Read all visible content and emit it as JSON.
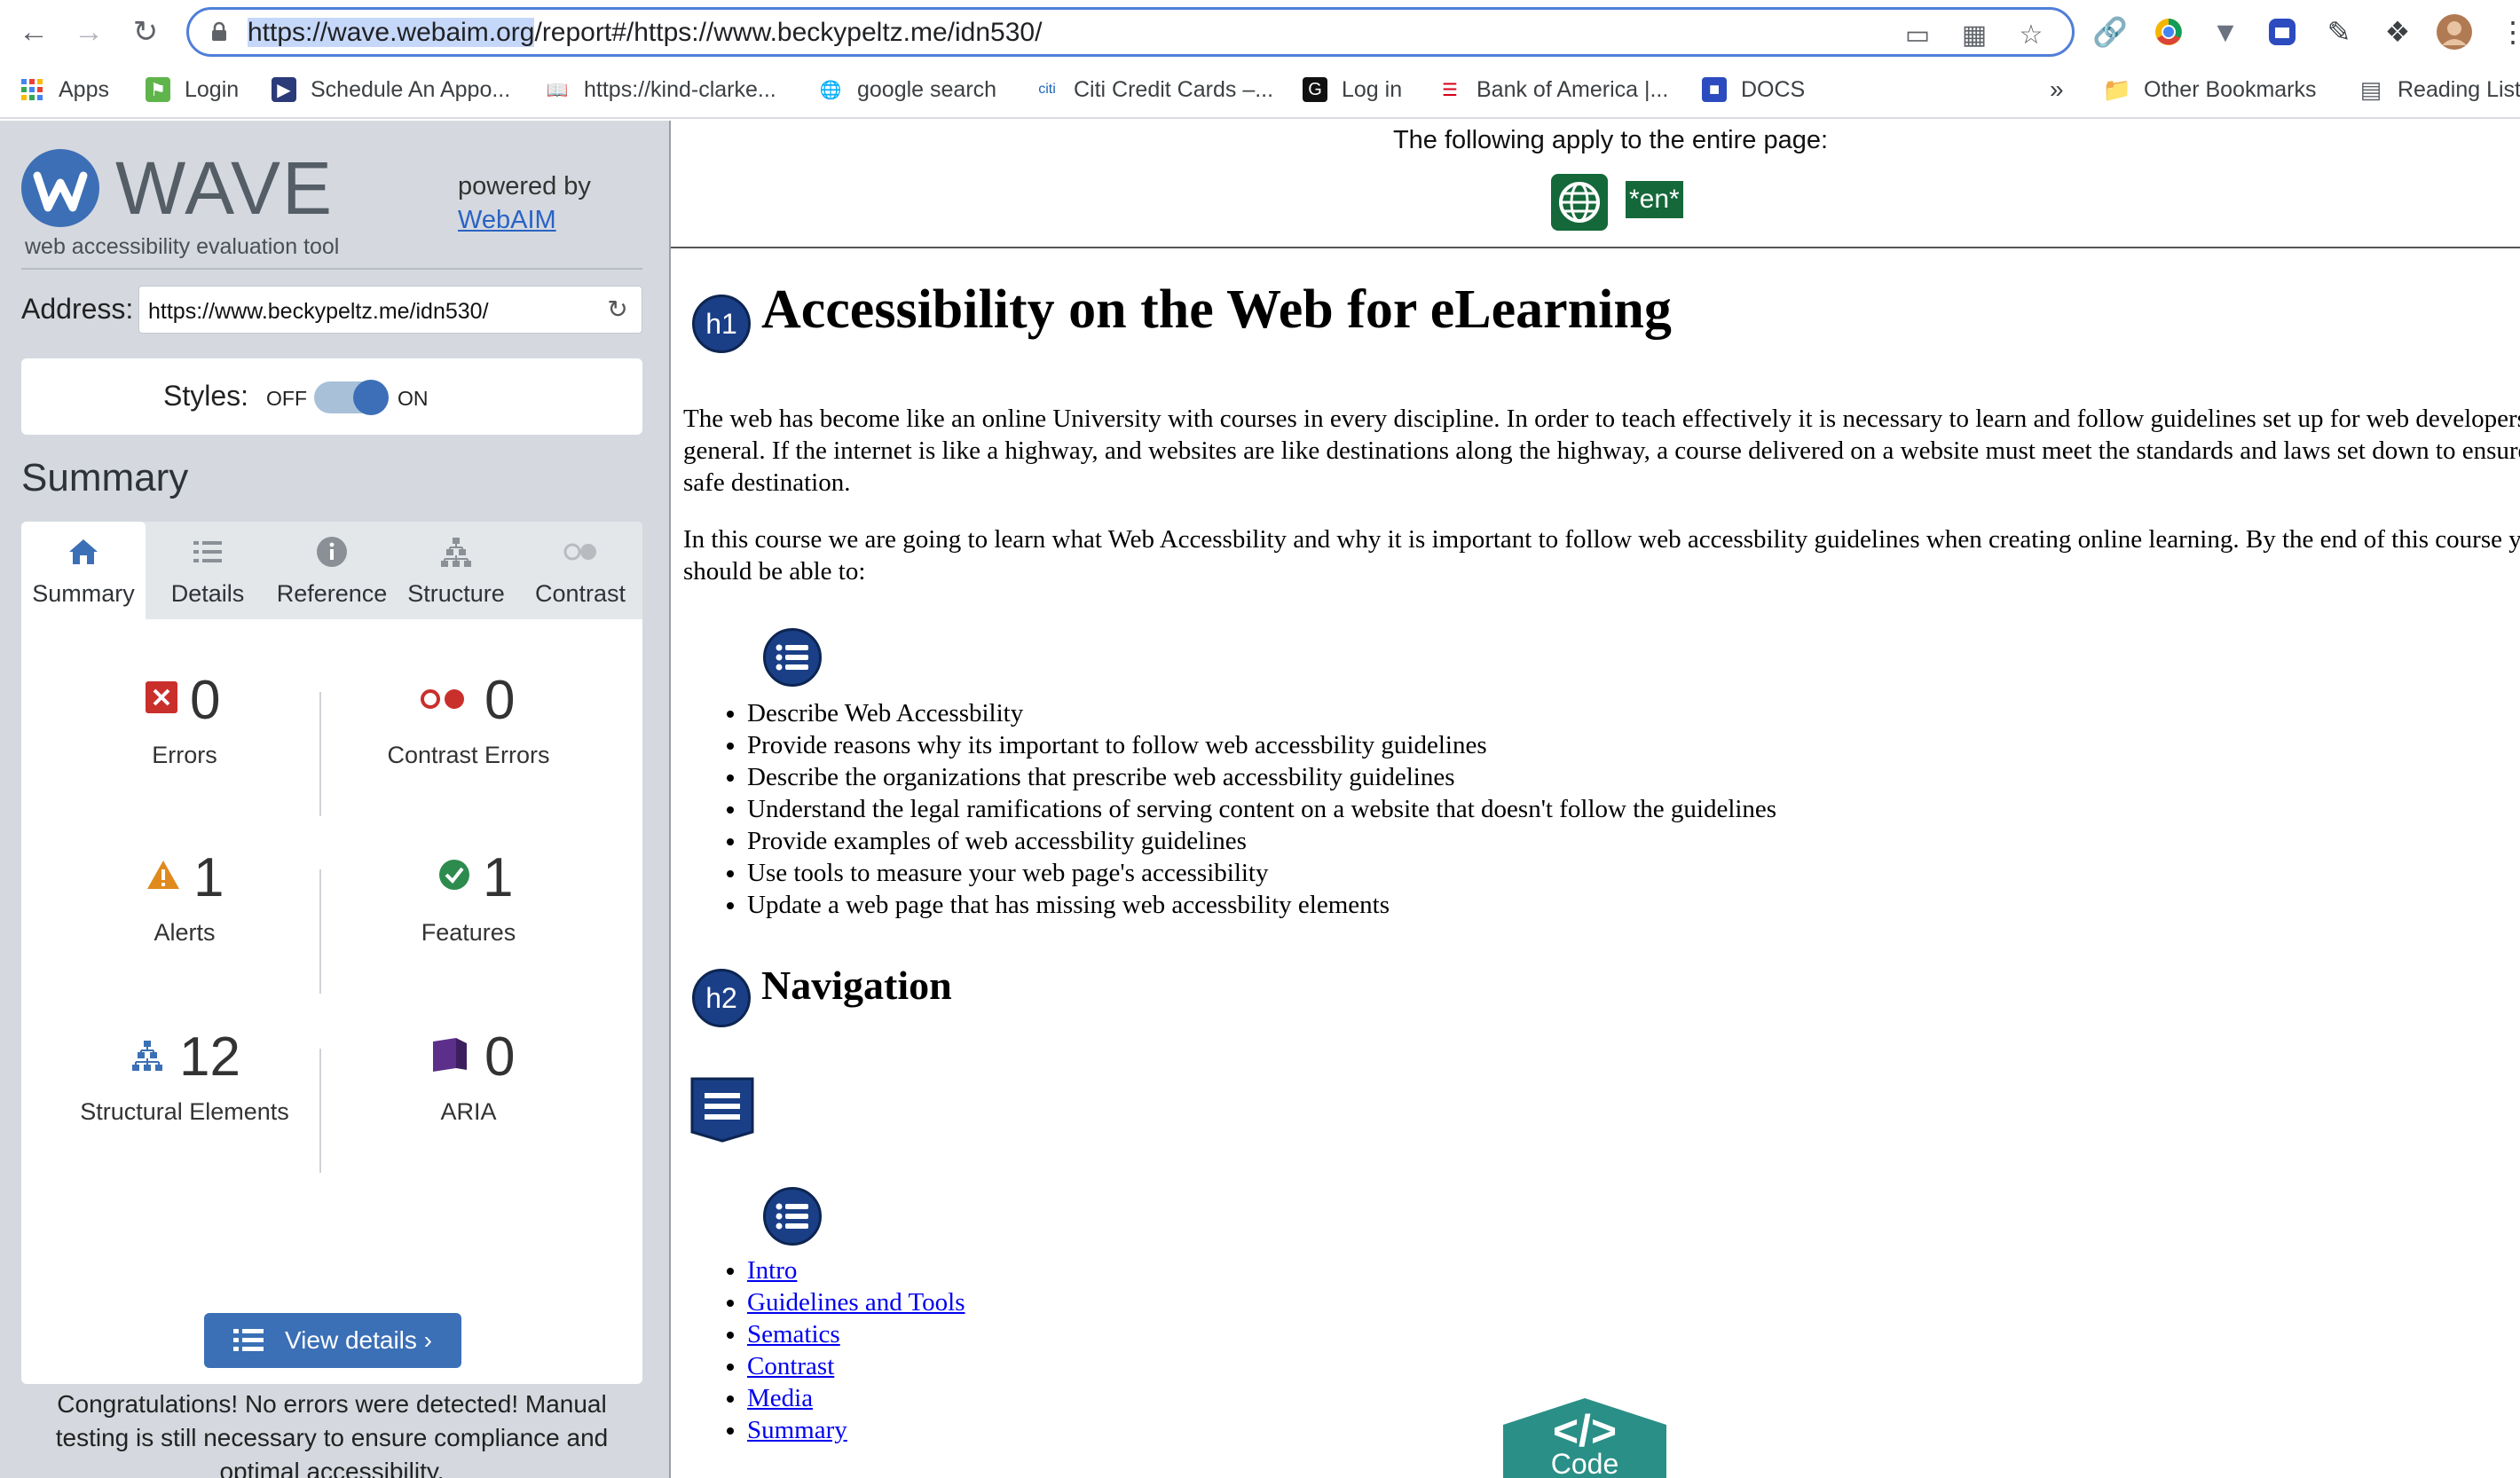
{
  "browser": {
    "url_selected": "https://wave.webaim.org",
    "url_rest": "/report#/https://www.beckypeltz.me/idn530/",
    "bookmarks": [
      {
        "label": "Apps",
        "icon": "apps-grid-icon"
      },
      {
        "label": "Login",
        "icon": "login-favicon"
      },
      {
        "label": "Schedule An Appo...",
        "icon": "usps-favicon"
      },
      {
        "label": "https://kind-clarke...",
        "icon": "book-favicon"
      },
      {
        "label": "google search",
        "icon": "globe-favicon"
      },
      {
        "label": "Citi Credit Cards –...",
        "icon": "citi-favicon"
      },
      {
        "label": "Log in",
        "icon": "login-g-favicon"
      },
      {
        "label": "Bank of America |...",
        "icon": "boa-favicon"
      },
      {
        "label": "DOCS",
        "icon": "docs-favicon"
      }
    ],
    "overflow": "»",
    "other_bookmarks": "Other Bookmarks",
    "reading_list": "Reading List"
  },
  "wave": {
    "logo_word": "WAVE",
    "tagline": "web accessibility evaluation tool",
    "powered_by": "powered by",
    "webaim": "WebAIM",
    "address_label": "Address:",
    "address_value": "https://www.beckypeltz.me/idn530/",
    "styles_label": "Styles:",
    "styles_off": "OFF",
    "styles_on": "ON",
    "summary_heading": "Summary",
    "tabs": [
      {
        "label": "Summary",
        "active": true
      },
      {
        "label": "Details"
      },
      {
        "label": "Reference"
      },
      {
        "label": "Structure"
      },
      {
        "label": "Contrast"
      }
    ],
    "stats": {
      "errors": {
        "value": "0",
        "label": "Errors"
      },
      "contrast_errors": {
        "value": "0",
        "label": "Contrast Errors"
      },
      "alerts": {
        "value": "1",
        "label": "Alerts"
      },
      "features": {
        "value": "1",
        "label": "Features"
      },
      "structural": {
        "value": "12",
        "label": "Structural Elements"
      },
      "aria": {
        "value": "0",
        "label": "ARIA"
      }
    },
    "view_details": "View details ›",
    "congrats": "Congratulations! No errors were detected! Manual testing is still necessary to ensure compliance and optimal accessibility."
  },
  "preview": {
    "apply_text": "The following apply to the entire page:",
    "lang_badge": "*en*",
    "h1_badge": "h1",
    "h1": "Accessibility on the Web for eLearning",
    "p1": "The web has become like an online University with courses in every discipline. In order to teach effectively it is necessary to learn and follow guidelines set up for web developers in general. If the internet is like a highway, and websites are like destinations along the highway, a course delivered on a website must meet the standards and laws set down to ensure a safe destination.",
    "p2": "In this course we are going to learn what Web Accessbility and why it is important to follow web accessbility guidelines when creating online learning. By the end of this course you should be able to:",
    "objectives": [
      "Describe Web Accessbility",
      "Provide reasons why its important to follow web accessbility guidelines",
      "Describe the organizations that prescribe web accessbility guidelines",
      "Understand the legal ramifications of serving content on a website that doesn't follow the guidelines",
      "Provide examples of web accessbility guidelines",
      "Use tools to measure your web page's accessibility",
      "Update a web page that has missing web accessbility elements"
    ],
    "h2_badge": "h2",
    "h2": "Navigation",
    "nav_links": [
      "Intro",
      "Guidelines and Tools",
      "Sematics",
      "Contrast",
      "Media",
      "Summary"
    ],
    "code_label": "Code",
    "code_symbol": "</>"
  }
}
